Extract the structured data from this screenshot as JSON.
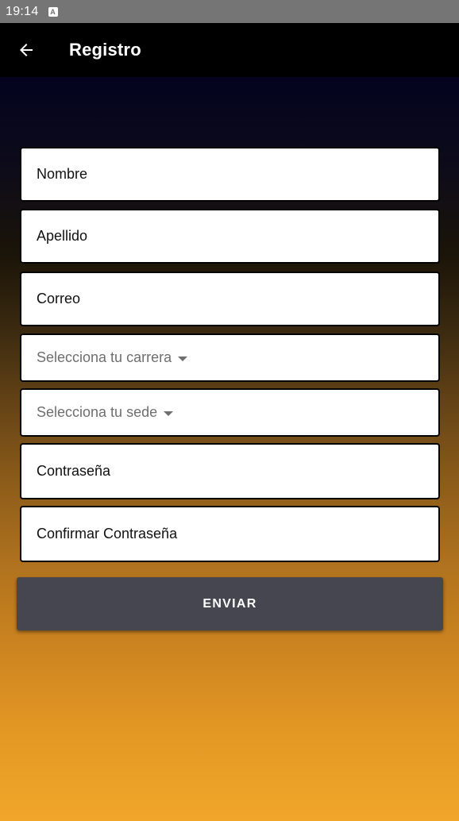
{
  "status_bar": {
    "time": "19:14",
    "notification_icon": "A"
  },
  "app_bar": {
    "back_icon": "arrow-left-icon",
    "title": "Registro"
  },
  "form": {
    "nombre": "Nombre",
    "apellido": "Apellido",
    "correo": "Correo",
    "carrera": "Selecciona tu carrera",
    "sede": "Selecciona tu sede",
    "contrasena": "Contraseña",
    "confirmar": "Confirmar Contraseña",
    "submit": "ENVIAR"
  },
  "colors": {
    "app_bar": "#000000",
    "status_bar": "#757575",
    "button": "#454650",
    "gradient_top": "#03031f",
    "gradient_bottom": "#f1a62a"
  }
}
